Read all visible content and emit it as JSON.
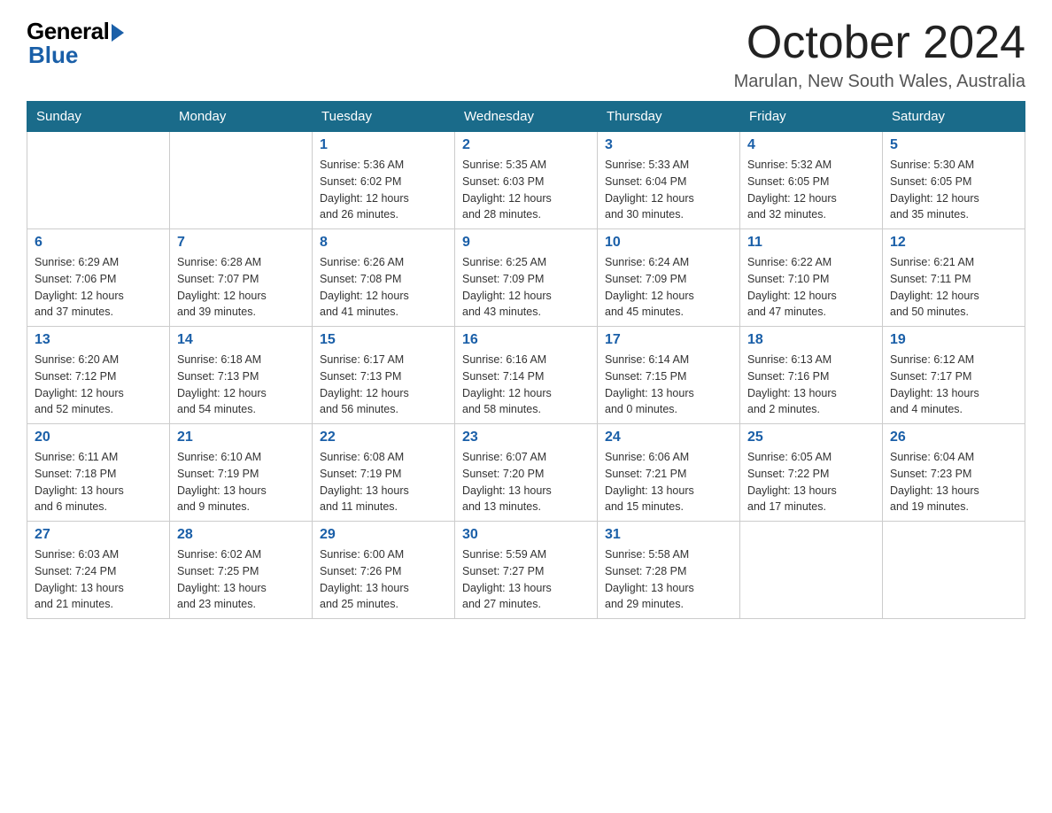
{
  "header": {
    "logo_general": "General",
    "logo_blue": "Blue",
    "month_title": "October 2024",
    "location": "Marulan, New South Wales, Australia"
  },
  "weekdays": [
    "Sunday",
    "Monday",
    "Tuesday",
    "Wednesday",
    "Thursday",
    "Friday",
    "Saturday"
  ],
  "weeks": [
    [
      {
        "day": "",
        "info": ""
      },
      {
        "day": "",
        "info": ""
      },
      {
        "day": "1",
        "info": "Sunrise: 5:36 AM\nSunset: 6:02 PM\nDaylight: 12 hours\nand 26 minutes."
      },
      {
        "day": "2",
        "info": "Sunrise: 5:35 AM\nSunset: 6:03 PM\nDaylight: 12 hours\nand 28 minutes."
      },
      {
        "day": "3",
        "info": "Sunrise: 5:33 AM\nSunset: 6:04 PM\nDaylight: 12 hours\nand 30 minutes."
      },
      {
        "day": "4",
        "info": "Sunrise: 5:32 AM\nSunset: 6:05 PM\nDaylight: 12 hours\nand 32 minutes."
      },
      {
        "day": "5",
        "info": "Sunrise: 5:30 AM\nSunset: 6:05 PM\nDaylight: 12 hours\nand 35 minutes."
      }
    ],
    [
      {
        "day": "6",
        "info": "Sunrise: 6:29 AM\nSunset: 7:06 PM\nDaylight: 12 hours\nand 37 minutes."
      },
      {
        "day": "7",
        "info": "Sunrise: 6:28 AM\nSunset: 7:07 PM\nDaylight: 12 hours\nand 39 minutes."
      },
      {
        "day": "8",
        "info": "Sunrise: 6:26 AM\nSunset: 7:08 PM\nDaylight: 12 hours\nand 41 minutes."
      },
      {
        "day": "9",
        "info": "Sunrise: 6:25 AM\nSunset: 7:09 PM\nDaylight: 12 hours\nand 43 minutes."
      },
      {
        "day": "10",
        "info": "Sunrise: 6:24 AM\nSunset: 7:09 PM\nDaylight: 12 hours\nand 45 minutes."
      },
      {
        "day": "11",
        "info": "Sunrise: 6:22 AM\nSunset: 7:10 PM\nDaylight: 12 hours\nand 47 minutes."
      },
      {
        "day": "12",
        "info": "Sunrise: 6:21 AM\nSunset: 7:11 PM\nDaylight: 12 hours\nand 50 minutes."
      }
    ],
    [
      {
        "day": "13",
        "info": "Sunrise: 6:20 AM\nSunset: 7:12 PM\nDaylight: 12 hours\nand 52 minutes."
      },
      {
        "day": "14",
        "info": "Sunrise: 6:18 AM\nSunset: 7:13 PM\nDaylight: 12 hours\nand 54 minutes."
      },
      {
        "day": "15",
        "info": "Sunrise: 6:17 AM\nSunset: 7:13 PM\nDaylight: 12 hours\nand 56 minutes."
      },
      {
        "day": "16",
        "info": "Sunrise: 6:16 AM\nSunset: 7:14 PM\nDaylight: 12 hours\nand 58 minutes."
      },
      {
        "day": "17",
        "info": "Sunrise: 6:14 AM\nSunset: 7:15 PM\nDaylight: 13 hours\nand 0 minutes."
      },
      {
        "day": "18",
        "info": "Sunrise: 6:13 AM\nSunset: 7:16 PM\nDaylight: 13 hours\nand 2 minutes."
      },
      {
        "day": "19",
        "info": "Sunrise: 6:12 AM\nSunset: 7:17 PM\nDaylight: 13 hours\nand 4 minutes."
      }
    ],
    [
      {
        "day": "20",
        "info": "Sunrise: 6:11 AM\nSunset: 7:18 PM\nDaylight: 13 hours\nand 6 minutes."
      },
      {
        "day": "21",
        "info": "Sunrise: 6:10 AM\nSunset: 7:19 PM\nDaylight: 13 hours\nand 9 minutes."
      },
      {
        "day": "22",
        "info": "Sunrise: 6:08 AM\nSunset: 7:19 PM\nDaylight: 13 hours\nand 11 minutes."
      },
      {
        "day": "23",
        "info": "Sunrise: 6:07 AM\nSunset: 7:20 PM\nDaylight: 13 hours\nand 13 minutes."
      },
      {
        "day": "24",
        "info": "Sunrise: 6:06 AM\nSunset: 7:21 PM\nDaylight: 13 hours\nand 15 minutes."
      },
      {
        "day": "25",
        "info": "Sunrise: 6:05 AM\nSunset: 7:22 PM\nDaylight: 13 hours\nand 17 minutes."
      },
      {
        "day": "26",
        "info": "Sunrise: 6:04 AM\nSunset: 7:23 PM\nDaylight: 13 hours\nand 19 minutes."
      }
    ],
    [
      {
        "day": "27",
        "info": "Sunrise: 6:03 AM\nSunset: 7:24 PM\nDaylight: 13 hours\nand 21 minutes."
      },
      {
        "day": "28",
        "info": "Sunrise: 6:02 AM\nSunset: 7:25 PM\nDaylight: 13 hours\nand 23 minutes."
      },
      {
        "day": "29",
        "info": "Sunrise: 6:00 AM\nSunset: 7:26 PM\nDaylight: 13 hours\nand 25 minutes."
      },
      {
        "day": "30",
        "info": "Sunrise: 5:59 AM\nSunset: 7:27 PM\nDaylight: 13 hours\nand 27 minutes."
      },
      {
        "day": "31",
        "info": "Sunrise: 5:58 AM\nSunset: 7:28 PM\nDaylight: 13 hours\nand 29 minutes."
      },
      {
        "day": "",
        "info": ""
      },
      {
        "day": "",
        "info": ""
      }
    ]
  ]
}
